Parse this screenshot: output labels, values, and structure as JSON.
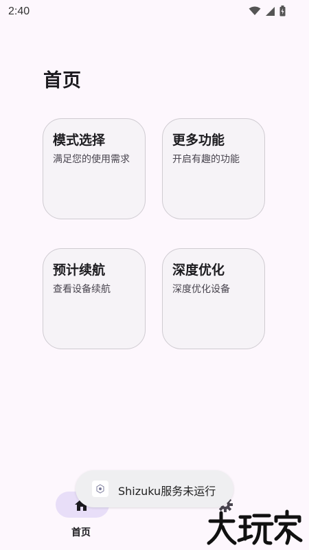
{
  "status_bar": {
    "time": "2:40",
    "icons": [
      "wifi-icon",
      "cell-signal-icon",
      "battery-icon"
    ]
  },
  "page": {
    "title": "首页"
  },
  "cards": [
    {
      "title": "模式选择",
      "subtitle": "满足您的使用需求"
    },
    {
      "title": "更多功能",
      "subtitle": "开启有趣的功能"
    },
    {
      "title": "预计续航",
      "subtitle": "查看设备续航"
    },
    {
      "title": "深度优化",
      "subtitle": "深度优化设备"
    }
  ],
  "bottom_nav": {
    "items": [
      {
        "label": "首页",
        "icon": "home-icon",
        "selected": true
      },
      {
        "label": "",
        "icon": "gear-icon",
        "selected": false
      }
    ]
  },
  "toast": {
    "text": "Shizuku服务未运行",
    "icon": "shizuku-icon"
  },
  "watermark": {
    "text": "大玩家"
  },
  "colors": {
    "background": "#FDF7FD",
    "card_bg": "#F6F3F7",
    "card_border": "#CFCBD1",
    "nav_indicator": "#E8DEF8",
    "toast_bg": "#EFEFF1"
  }
}
